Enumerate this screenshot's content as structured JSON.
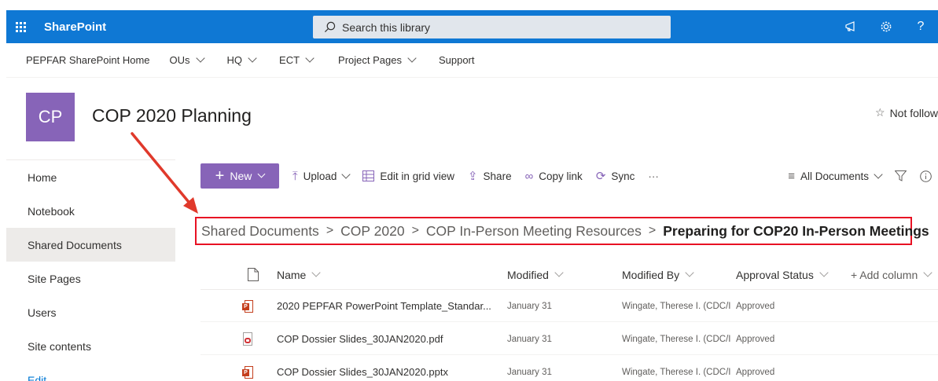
{
  "suitebar": {
    "app_name": "SharePoint",
    "search_placeholder": "Search this library",
    "colors": {
      "background": "#0f78d4",
      "accent": "#8764b8"
    }
  },
  "hubnav": {
    "items": [
      {
        "label": "PEPFAR SharePoint Home",
        "dropdown": false
      },
      {
        "label": "OUs",
        "dropdown": true
      },
      {
        "label": "HQ",
        "dropdown": true
      },
      {
        "label": "ECT",
        "dropdown": true
      },
      {
        "label": "Project Pages",
        "dropdown": true
      },
      {
        "label": "Support",
        "dropdown": false
      }
    ]
  },
  "site": {
    "logo_text": "CP",
    "title": "COP 2020 Planning",
    "follow_label": "Not follow"
  },
  "leftnav": {
    "items": [
      {
        "label": "Home"
      },
      {
        "label": "Notebook"
      },
      {
        "label": "Shared Documents",
        "selected": true
      },
      {
        "label": "Site Pages"
      },
      {
        "label": "Users"
      },
      {
        "label": "Site contents"
      },
      {
        "label": "Edit"
      }
    ]
  },
  "commandbar": {
    "new_label": "New",
    "upload_label": "Upload",
    "edit_grid_label": "Edit in grid view",
    "share_label": "Share",
    "copy_link_label": "Copy link",
    "sync_label": "Sync",
    "more_label": "···",
    "view_label": "All Documents"
  },
  "breadcrumb": {
    "items": [
      "Shared Documents",
      "COP 2020",
      "COP In-Person Meeting Resources"
    ],
    "current": "Preparing for COP20 In-Person Meetings"
  },
  "list": {
    "columns": {
      "name": "Name",
      "modified": "Modified",
      "modified_by": "Modified By",
      "approval_status": "Approval Status",
      "add_column": "+ Add column"
    },
    "rows": [
      {
        "type": "pptx",
        "name": "2020 PEPFAR PowerPoint Template_Standar...",
        "modified": "January 31",
        "modified_by": "Wingate, Therese I. (CDC/I",
        "approval_status": "Approved"
      },
      {
        "type": "pdf",
        "name": "COP Dossier Slides_30JAN2020.pdf",
        "modified": "January 31",
        "modified_by": "Wingate, Therese I. (CDC/I",
        "approval_status": "Approved"
      },
      {
        "type": "pptx",
        "name": "COP Dossier Slides_30JAN2020.pptx",
        "modified": "January 31",
        "modified_by": "Wingate, Therese I. (CDC/I",
        "approval_status": "Approved"
      }
    ]
  }
}
